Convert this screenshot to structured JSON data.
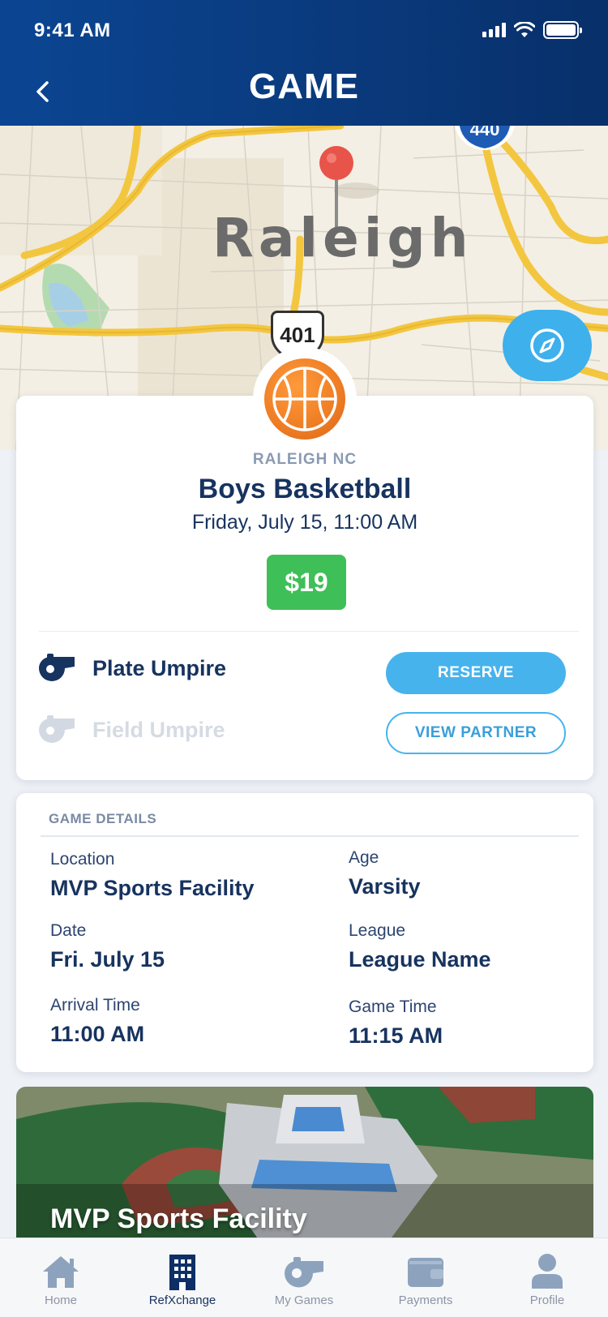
{
  "status_bar": {
    "time": "9:41 AM"
  },
  "header": {
    "title": "GAME"
  },
  "map": {
    "city_label": "Raleigh",
    "route_number": "401",
    "interstate_number": "440"
  },
  "game": {
    "location": "RALEIGH NC",
    "title": "Boys Basketball",
    "datetime": "Friday, July 15, 11:00 AM",
    "price": "$19",
    "roles": [
      {
        "label": "Plate Umpire",
        "button": "RESERVE",
        "active": true
      },
      {
        "label": "Field Umpire",
        "button": "VIEW PARTNER",
        "active": false
      }
    ]
  },
  "details": {
    "heading": "GAME DETAILS",
    "items": [
      {
        "label": "Location",
        "value": "MVP Sports Facility"
      },
      {
        "label": "Age",
        "value": "Varsity"
      },
      {
        "label": "Date",
        "value": "Fri. July 15"
      },
      {
        "label": "League",
        "value": "League Name"
      },
      {
        "label": "Arrival Time",
        "value": "11:00 AM"
      },
      {
        "label": "Game Time",
        "value": "11:15 AM"
      }
    ]
  },
  "facility": {
    "name": "MVP Sports Facility"
  },
  "tabs": [
    {
      "label": "Home",
      "icon": "home-icon",
      "active": false
    },
    {
      "label": "RefXchange",
      "icon": "building-icon",
      "active": true
    },
    {
      "label": "My Games",
      "icon": "whistle-icon",
      "active": false
    },
    {
      "label": "Payments",
      "icon": "wallet-icon",
      "active": false
    },
    {
      "label": "Profile",
      "icon": "user-icon",
      "active": false
    }
  ],
  "colors": {
    "header": "#0b4592",
    "accent": "#47b3ed",
    "price": "#3fbf57",
    "navy": "#17335f"
  }
}
